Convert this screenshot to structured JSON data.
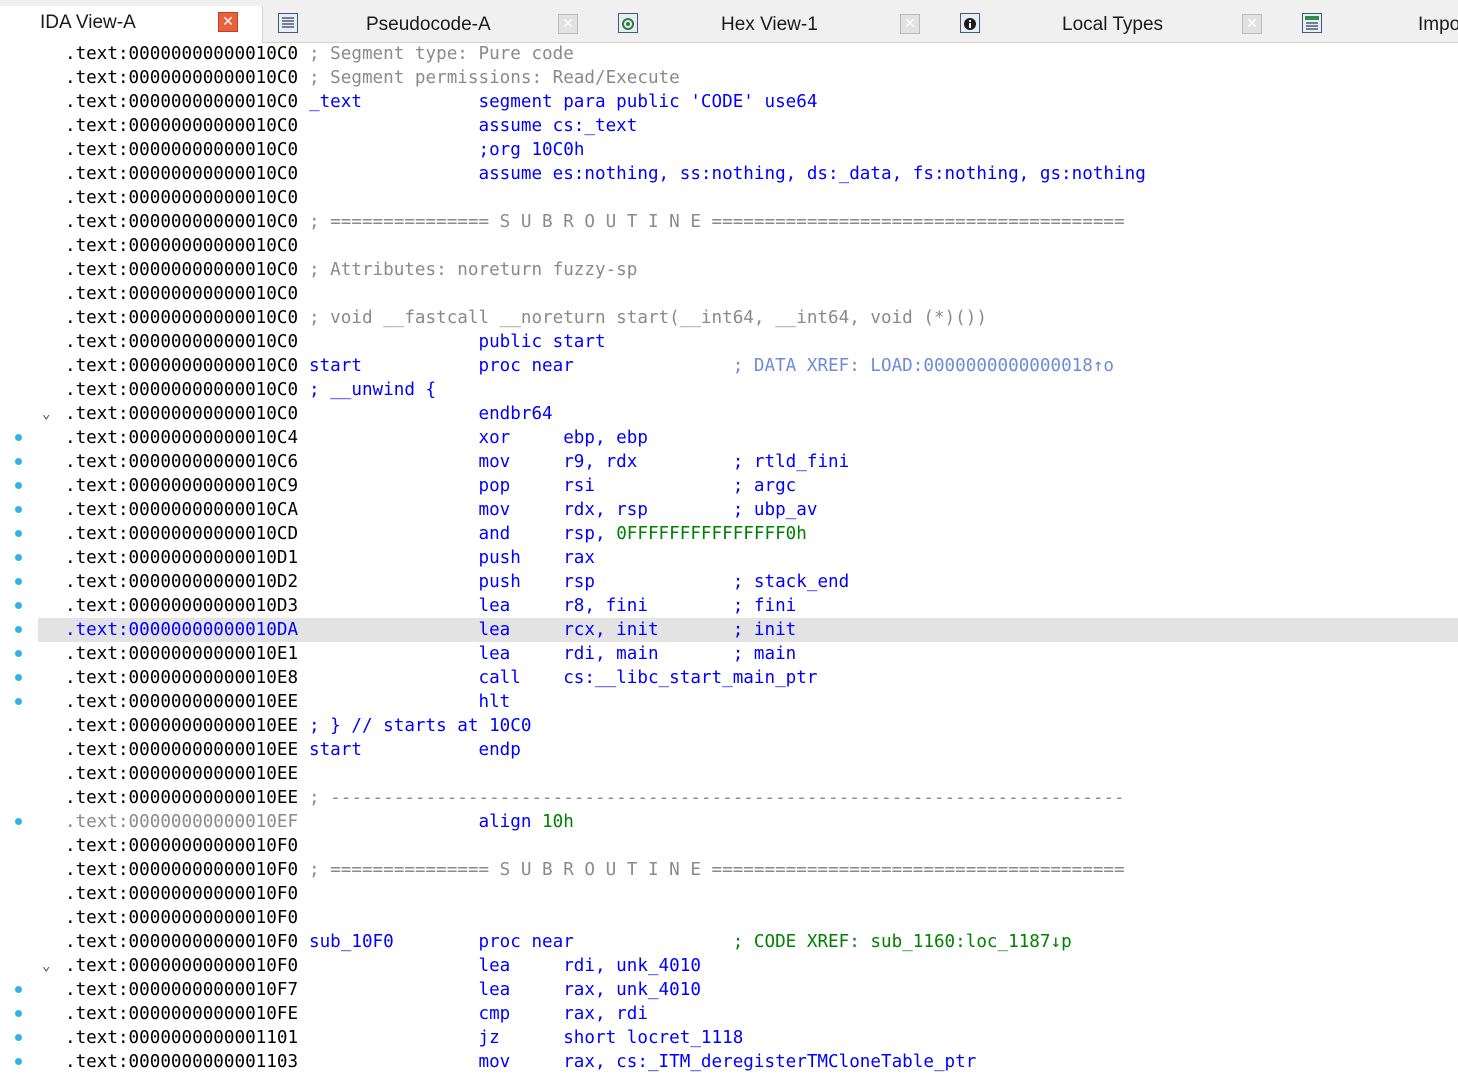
{
  "tabs": [
    {
      "label": "IDA View-A",
      "icon": "none",
      "active": true
    },
    {
      "label": "Pseudocode-A",
      "icon": "pseudocode-icon",
      "active": false
    },
    {
      "label": "Hex View-1",
      "icon": "hex-icon",
      "active": false
    },
    {
      "label": "Local Types",
      "icon": "info-icon",
      "active": false
    },
    {
      "label": "Impo",
      "icon": "imports-icon",
      "active": false
    }
  ],
  "colors": {
    "instruction": "#0000ff",
    "comment": "#8a8a8a",
    "immediate": "#008000",
    "xref": "#6c8cd8",
    "highlight": "#e3e3e3",
    "breakpoint_dot": "#35b3e8",
    "close_active": "#e8613a"
  },
  "listing": [
    {
      "addr": ".text:00000000000010C0",
      "text": "; Segment type: Pure code"
    },
    {
      "addr": ".text:00000000000010C0",
      "text": "; Segment permissions: Read/Execute"
    },
    {
      "addr": ".text:00000000000010C0",
      "text": "_text           segment para public 'CODE' use64"
    },
    {
      "addr": ".text:00000000000010C0",
      "text": "                assume cs:_text"
    },
    {
      "addr": ".text:00000000000010C0",
      "text": "                ;org 10C0h"
    },
    {
      "addr": ".text:00000000000010C0",
      "text": "                assume es:nothing, ss:nothing, ds:_data, fs:nothing, gs:nothing"
    },
    {
      "addr": ".text:00000000000010C0",
      "text": ""
    },
    {
      "addr": ".text:00000000000010C0",
      "text": "; =============== S U B R O U T I N E ======================================="
    },
    {
      "addr": ".text:00000000000010C0",
      "text": ""
    },
    {
      "addr": ".text:00000000000010C0",
      "text": "; Attributes: noreturn fuzzy-sp"
    },
    {
      "addr": ".text:00000000000010C0",
      "text": ""
    },
    {
      "addr": ".text:00000000000010C0",
      "text": "; void __fastcall __noreturn start(__int64, __int64, void (*)())"
    },
    {
      "addr": ".text:00000000000010C0",
      "text": "                public start"
    },
    {
      "addr": ".text:00000000000010C0",
      "text": "start           proc near               ; DATA XREF: LOAD:0000000000000018↑o"
    },
    {
      "addr": ".text:00000000000010C0",
      "text": "; __unwind {"
    },
    {
      "addr": ".text:00000000000010C0",
      "text": "                endbr64"
    },
    {
      "addr": ".text:00000000000010C4",
      "text": "                xor     ebp, ebp"
    },
    {
      "addr": ".text:00000000000010C6",
      "text": "                mov     r9, rdx         ; rtld_fini"
    },
    {
      "addr": ".text:00000000000010C9",
      "text": "                pop     rsi             ; argc"
    },
    {
      "addr": ".text:00000000000010CA",
      "text": "                mov     rdx, rsp        ; ubp_av"
    },
    {
      "addr": ".text:00000000000010CD",
      "text": "                and     rsp, 0FFFFFFFFFFFFFFF0h"
    },
    {
      "addr": ".text:00000000000010D1",
      "text": "                push    rax"
    },
    {
      "addr": ".text:00000000000010D2",
      "text": "                push    rsp             ; stack_end"
    },
    {
      "addr": ".text:00000000000010D3",
      "text": "                lea     r8, fini        ; fini"
    },
    {
      "addr": ".text:00000000000010DA",
      "text": "                lea     rcx, init       ; init"
    },
    {
      "addr": ".text:00000000000010E1",
      "text": "                lea     rdi, main       ; main"
    },
    {
      "addr": ".text:00000000000010E8",
      "text": "                call    cs:__libc_start_main_ptr"
    },
    {
      "addr": ".text:00000000000010EE",
      "text": "                hlt"
    },
    {
      "addr": ".text:00000000000010EE",
      "text": "; } // starts at 10C0"
    },
    {
      "addr": ".text:00000000000010EE",
      "text": "start           endp"
    },
    {
      "addr": ".text:00000000000010EE",
      "text": ""
    },
    {
      "addr": ".text:00000000000010EE",
      "text": "; ---------------------------------------------------------------------------"
    },
    {
      "addr": ".text:00000000000010EF",
      "text": "                align 10h"
    },
    {
      "addr": ".text:00000000000010F0",
      "text": ""
    },
    {
      "addr": ".text:00000000000010F0",
      "text": "; =============== S U B R O U T I N E ======================================="
    },
    {
      "addr": ".text:00000000000010F0",
      "text": ""
    },
    {
      "addr": ".text:00000000000010F0",
      "text": ""
    },
    {
      "addr": ".text:00000000000010F0",
      "text": "sub_10F0        proc near               ; CODE XREF: sub_1160:loc_1187↓p"
    },
    {
      "addr": ".text:00000000000010F0",
      "text": "                lea     rdi, unk_4010"
    },
    {
      "addr": ".text:00000000000010F7",
      "text": "                lea     rax, unk_4010"
    },
    {
      "addr": ".text:00000000000010FE",
      "text": "                cmp     rax, rdi"
    },
    {
      "addr": ".text:0000000000001101",
      "text": "                jz      short locret_1118"
    },
    {
      "addr": ".text:0000000000001103",
      "text": "                mov     rax, cs:_ITM_deregisterTMCloneTable_ptr"
    }
  ]
}
